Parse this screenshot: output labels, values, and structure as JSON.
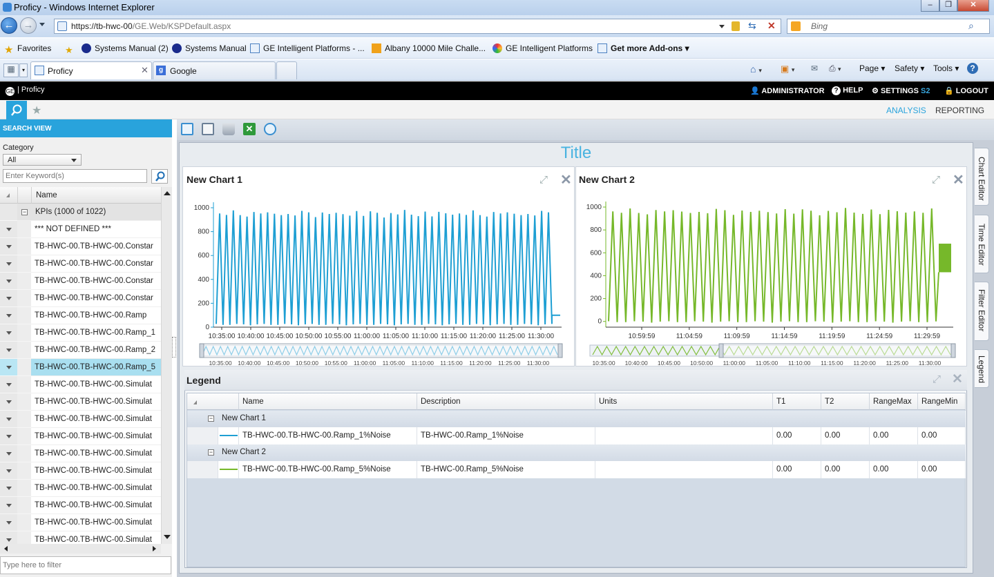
{
  "browser": {
    "window_title": "Proficy - Windows Internet Explorer",
    "url_prefix": "https://tb-hwc-00",
    "url_path": "/GE.Web/KSPDefault.aspx",
    "search_placeholder": "Bing",
    "favorites_label": "Favorites",
    "favorites": [
      "Systems Manual (2)",
      "Systems Manual",
      "GE Intelligent Platforms - ...",
      "Albany 10000 Mile Challe...",
      "GE Intelligent Platforms",
      "Get more Add-ons"
    ],
    "tabs": [
      "Proficy",
      "Google"
    ],
    "commands": [
      "Page",
      "Safety",
      "Tools"
    ]
  },
  "app": {
    "brand": "Proficy",
    "user": "ADMINISTRATOR",
    "help": "HELP",
    "settings": "SETTINGS",
    "settings_suffix": "S2",
    "logout": "LOGOUT",
    "nav": [
      "ANALYSIS",
      "REPORTING"
    ]
  },
  "search": {
    "header": "SEARCH VIEW",
    "category_label": "Category",
    "category_value": "All",
    "keyword_placeholder": "Enter Keyword(s)",
    "column_name": "Name",
    "group_label": "KPIs (1000 of 1022)",
    "items": [
      "*** NOT DEFINED ***",
      "TB-HWC-00.TB-HWC-00.Constar",
      "TB-HWC-00.TB-HWC-00.Constar",
      "TB-HWC-00.TB-HWC-00.Constar",
      "TB-HWC-00.TB-HWC-00.Constar",
      "TB-HWC-00.TB-HWC-00.Ramp",
      "TB-HWC-00.TB-HWC-00.Ramp_1",
      "TB-HWC-00.TB-HWC-00.Ramp_2",
      "TB-HWC-00.TB-HWC-00.Ramp_5",
      "TB-HWC-00.TB-HWC-00.Simulat",
      "TB-HWC-00.TB-HWC-00.Simulat",
      "TB-HWC-00.TB-HWC-00.Simulat",
      "TB-HWC-00.TB-HWC-00.Simulat",
      "TB-HWC-00.TB-HWC-00.Simulat",
      "TB-HWC-00.TB-HWC-00.Simulat",
      "TB-HWC-00.TB-HWC-00.Simulat",
      "TB-HWC-00.TB-HWC-00.Simulat",
      "TB-HWC-00.TB-HWC-00.Simulat",
      "TB-HWC-00.TB-HWC-00.Simulat"
    ],
    "filter_placeholder": "Type here to filter"
  },
  "workspace": {
    "title": "Title",
    "side_tabs": [
      "Chart Editor",
      "Time Editor",
      "Filter Editor",
      "Legend"
    ]
  },
  "chart_data": [
    {
      "type": "line",
      "title": "New Chart 1",
      "color": "#1e9fd3",
      "ylim": [
        0,
        1000
      ],
      "y_ticks": [
        "0",
        "200",
        "400",
        "600",
        "800",
        "1000"
      ],
      "x_ticks": [
        "10:35:00",
        "10:40:00",
        "10:45:00",
        "10:50:00",
        "10:55:00",
        "11:00:00",
        "11:05:00",
        "11:10:00",
        "11:15:00",
        "11:20:00",
        "11:25:00",
        "11:30:00"
      ],
      "navigator_ticks": [
        "10:35:00",
        "10:40:00",
        "10:45:00",
        "10:50:00",
        "10:55:00",
        "11:00:00",
        "11:05:00",
        "11:10:00",
        "11:15:00",
        "11:20:00",
        "11:25:00",
        "11:30:00"
      ],
      "series": [
        {
          "name": "TB-HWC-00.TB-HWC-00.Ramp_1%Noise",
          "peak": 970,
          "trough": 15,
          "cycles": 49,
          "end_value": 100
        }
      ]
    },
    {
      "type": "line",
      "title": "New Chart 2",
      "color": "#76b82a",
      "ylim": [
        -50,
        1000
      ],
      "y_ticks": [
        "0",
        "200",
        "400",
        "600",
        "800",
        "1000"
      ],
      "x_ticks": [
        "10:59:59",
        "11:04:59",
        "11:09:59",
        "11:14:59",
        "11:19:59",
        "11:24:59",
        "11:29:59"
      ],
      "navigator_ticks": [
        "10:35:00",
        "10:40:00",
        "10:45:00",
        "10:50:00",
        "11:00:00",
        "11:05:00",
        "11:10:00",
        "11:15:00",
        "11:20:00",
        "11:25:00",
        "11:30:00"
      ],
      "series": [
        {
          "name": "TB-HWC-00.TB-HWC-00.Ramp_5%Noise",
          "peak": 980,
          "trough": -10,
          "cycles": 38,
          "band": [
            430,
            680
          ]
        }
      ]
    }
  ],
  "legend": {
    "title": "Legend",
    "columns": [
      "Name",
      "Description",
      "Units",
      "T1",
      "T2",
      "RangeMax",
      "RangeMin"
    ],
    "groups": [
      {
        "label": "New Chart 1",
        "color": "#1e9fd3",
        "row": [
          "TB-HWC-00.TB-HWC-00.Ramp_1%Noise",
          "TB-HWC-00.Ramp_1%Noise",
          "",
          "0.00",
          "0.00",
          "0.00",
          "0.00"
        ]
      },
      {
        "label": "New Chart 2",
        "color": "#76b82a",
        "row": [
          "TB-HWC-00.TB-HWC-00.Ramp_5%Noise",
          "TB-HWC-00.Ramp_5%Noise",
          "",
          "0.00",
          "0.00",
          "0.00",
          "0.00"
        ]
      }
    ]
  }
}
